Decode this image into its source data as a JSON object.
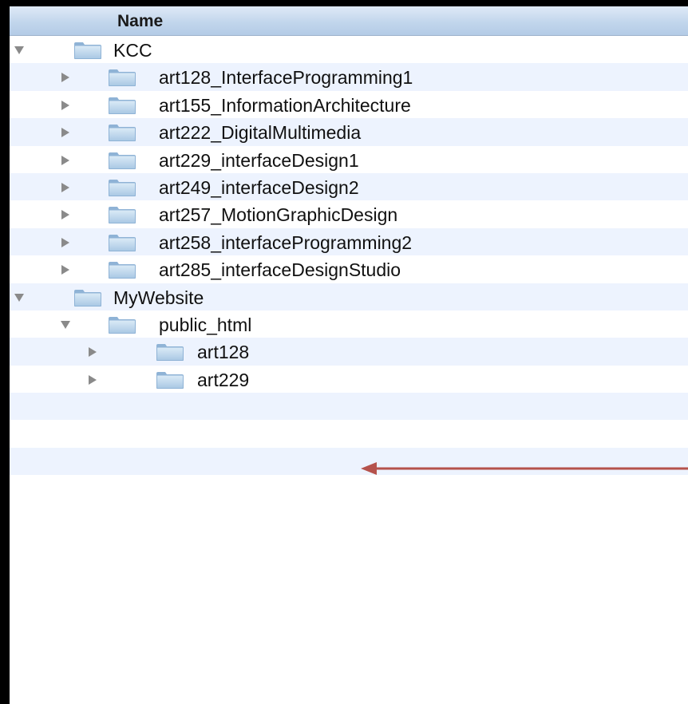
{
  "header": {
    "name_column": "Name"
  },
  "tree": [
    {
      "label": "KCC",
      "level": 0,
      "expanded": true,
      "icon": "folder-icon"
    },
    {
      "label": "art128_InterfaceProgramming1",
      "level": 1,
      "expanded": false,
      "icon": "folder-icon"
    },
    {
      "label": "art155_InformationArchitecture",
      "level": 1,
      "expanded": false,
      "icon": "folder-icon"
    },
    {
      "label": "art222_DigitalMultimedia",
      "level": 1,
      "expanded": false,
      "icon": "folder-icon"
    },
    {
      "label": "art229_interfaceDesign1",
      "level": 1,
      "expanded": false,
      "icon": "folder-icon"
    },
    {
      "label": "art249_interfaceDesign2",
      "level": 1,
      "expanded": false,
      "icon": "folder-icon"
    },
    {
      "label": "art257_MotionGraphicDesign",
      "level": 1,
      "expanded": false,
      "icon": "folder-icon"
    },
    {
      "label": "art258_interfaceProgramming2",
      "level": 1,
      "expanded": false,
      "icon": "folder-icon"
    },
    {
      "label": "art285_interfaceDesignStudio",
      "level": 1,
      "expanded": false,
      "icon": "folder-icon"
    },
    {
      "label": "MyWebsite",
      "level": 0,
      "expanded": true,
      "icon": "folder-icon"
    },
    {
      "label": "public_html",
      "level": 1,
      "expanded": true,
      "icon": "folder-icon"
    },
    {
      "label": "art128",
      "level": 2,
      "expanded": false,
      "icon": "folder-icon"
    },
    {
      "label": "art229",
      "level": 2,
      "expanded": false,
      "icon": "folder-icon"
    }
  ],
  "empty_rows": 4,
  "annotation": {
    "icon": "red-arrow-icon",
    "color": "#b5524c",
    "points_to": "public_html"
  },
  "colors": {
    "row_alt": "#edf3fe",
    "folder_light": "#c3dcf0",
    "folder_dark": "#8fb3d6"
  }
}
